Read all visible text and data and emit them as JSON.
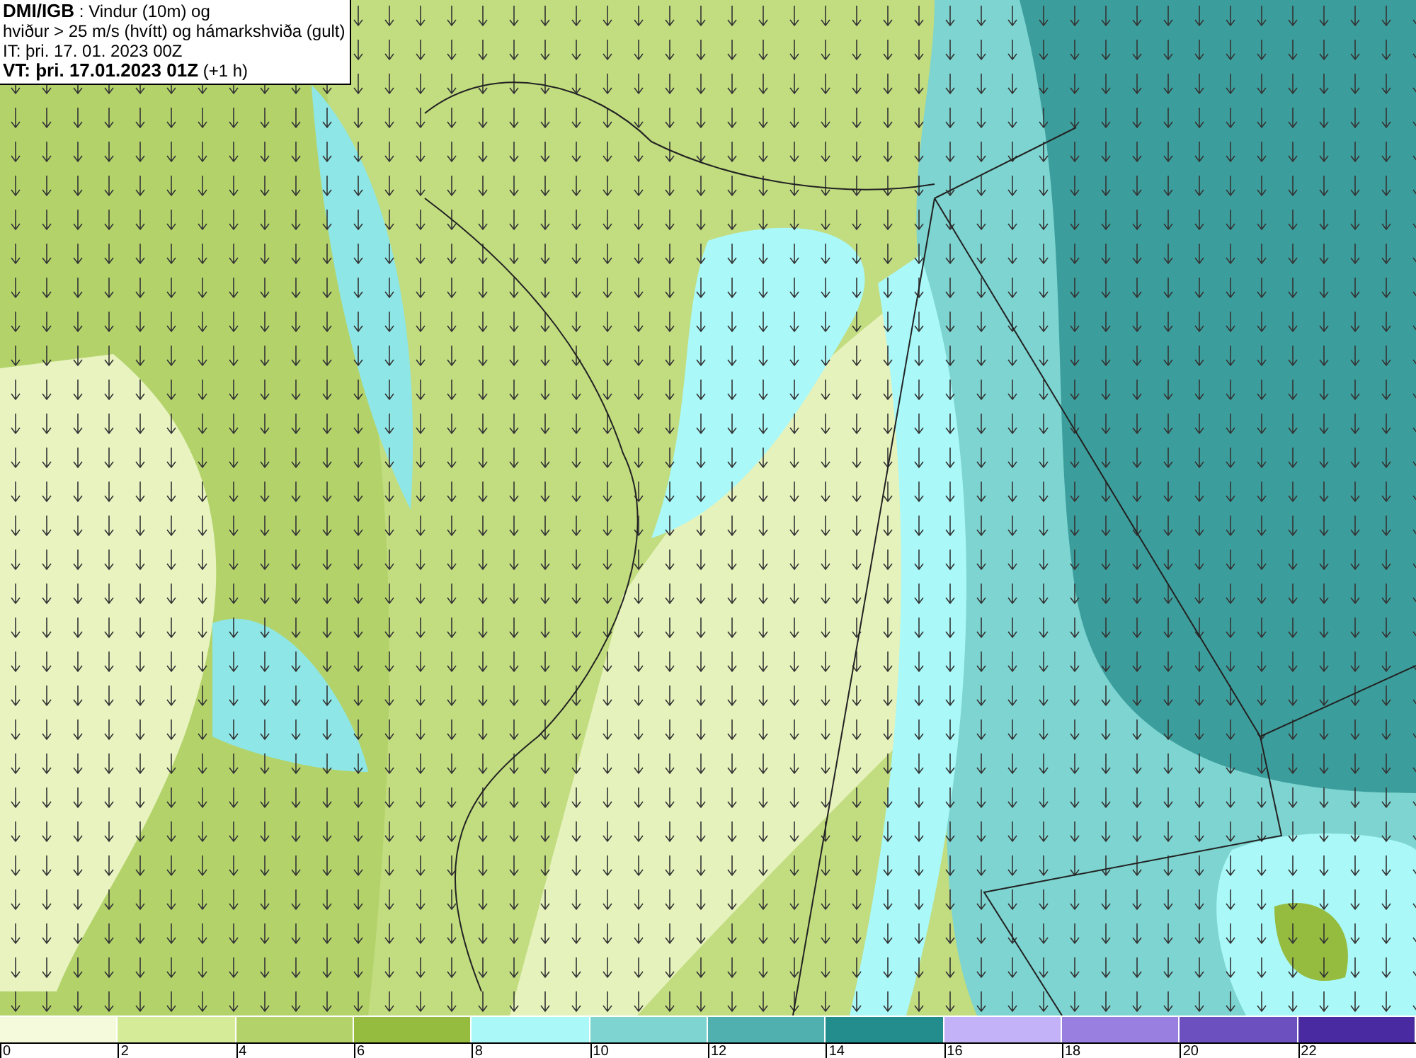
{
  "header": {
    "lines": [
      "**DMI/IGB** : Vindur (10m) og",
      "hviður > 25 m/s (hvítt) og hámarkshviða (gult)",
      "IT: þri. 17. 01. 2023 00Z",
      "**VT: þri. 17.01.2023 01Z** (+1 h)"
    ]
  },
  "legend": {
    "bins": [
      {
        "color": "#f6fadc"
      },
      {
        "color": "#d5eb98"
      },
      {
        "color": "#b3d36a"
      },
      {
        "color": "#95bc3e"
      },
      {
        "color": "#aaf8f8"
      },
      {
        "color": "#7dd4d0"
      },
      {
        "color": "#50b0b0"
      },
      {
        "color": "#238c8c"
      },
      {
        "color": "#c4b2f8"
      },
      {
        "color": "#9980e0"
      },
      {
        "color": "#6c50c0"
      },
      {
        "color": "#4a2aa0"
      }
    ],
    "ticks": [
      "0",
      "2",
      "4",
      "6",
      "8",
      "10",
      "12",
      "14",
      "16",
      "18",
      "20",
      "22"
    ]
  }
}
